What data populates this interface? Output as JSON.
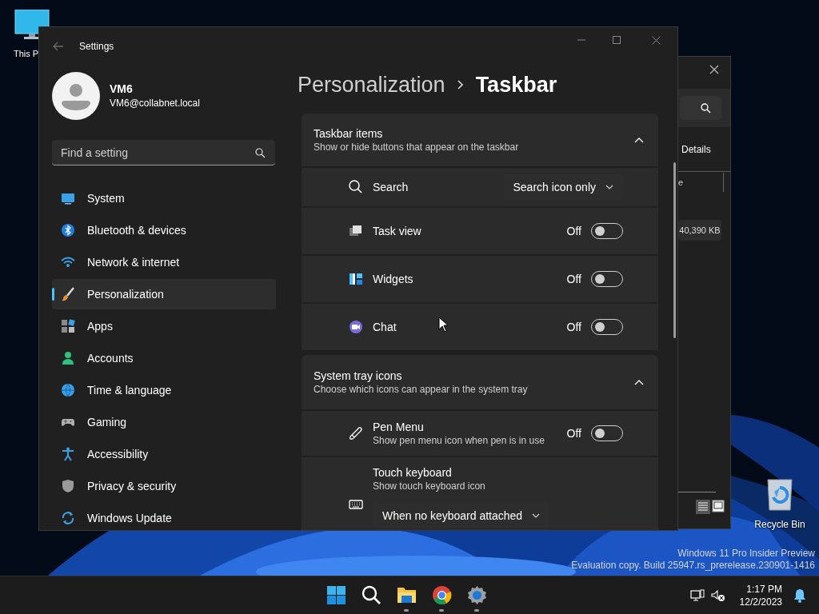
{
  "desktop": {
    "icons": [
      {
        "label": "This P"
      },
      {
        "label": "Recycle Bin"
      }
    ],
    "build_info": [
      "Windows 11 Pro Insider Preview",
      "Evaluation copy. Build 25947.rs_prerelease.230901-1416"
    ]
  },
  "background_window": {
    "tab": "Details",
    "column_header": "e",
    "cell": "40,390 KB"
  },
  "settings": {
    "title": "Settings",
    "user": {
      "name": "VM6",
      "email": "VM6@collabnet.local"
    },
    "search": {
      "placeholder": "Find a setting"
    },
    "nav": [
      {
        "label": "System",
        "selected": false
      },
      {
        "label": "Bluetooth & devices",
        "selected": false
      },
      {
        "label": "Network & internet",
        "selected": false
      },
      {
        "label": "Personalization",
        "selected": true
      },
      {
        "label": "Apps",
        "selected": false
      },
      {
        "label": "Accounts",
        "selected": false
      },
      {
        "label": "Time & language",
        "selected": false
      },
      {
        "label": "Gaming",
        "selected": false
      },
      {
        "label": "Accessibility",
        "selected": false
      },
      {
        "label": "Privacy & security",
        "selected": false
      },
      {
        "label": "Windows Update",
        "selected": false
      }
    ],
    "breadcrumb": [
      "Personalization",
      "Taskbar"
    ],
    "sections": [
      {
        "title": "Taskbar items",
        "subtitle": "Show or hide buttons that appear on the taskbar",
        "expanded": true,
        "rows": [
          {
            "kind": "dropdown",
            "label": "Search",
            "value": "Search icon only"
          },
          {
            "kind": "toggle",
            "label": "Task view",
            "state_text": "Off",
            "on": false
          },
          {
            "kind": "toggle",
            "label": "Widgets",
            "state_text": "Off",
            "on": false
          },
          {
            "kind": "toggle",
            "label": "Chat",
            "state_text": "Off",
            "on": false
          }
        ]
      },
      {
        "title": "System tray icons",
        "subtitle": "Choose which icons can appear in the system tray",
        "expanded": true,
        "rows": [
          {
            "kind": "toggle",
            "label": "Pen Menu",
            "subtitle": "Show pen menu icon when pen is in use",
            "state_text": "Off",
            "on": false
          },
          {
            "kind": "dropdown_below",
            "label": "Touch keyboard",
            "subtitle": "Show touch keyboard icon",
            "value": "When no keyboard attached"
          }
        ]
      }
    ]
  },
  "taskbar": {
    "apps": [
      {
        "running": false
      },
      {
        "running": false
      },
      {
        "running": true
      },
      {
        "running": true
      },
      {
        "running": true
      }
    ],
    "time": "1:17 PM",
    "date": "12/2/2023"
  }
}
